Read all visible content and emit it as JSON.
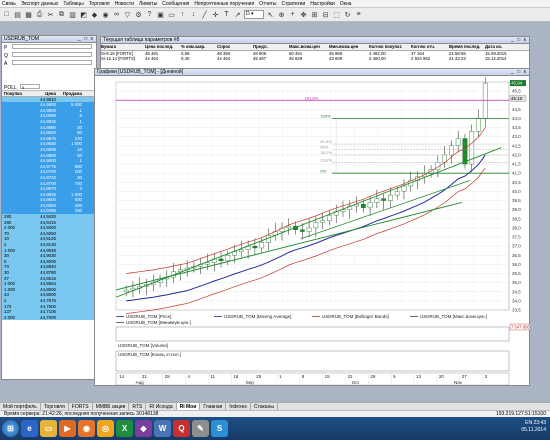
{
  "menu": [
    "Связь",
    "Экспорт данных",
    "Таблицы",
    "Торговля",
    "Новости",
    "Лимиты",
    "Сообщения",
    "Непрочтенные поручения",
    "Отчеты",
    "Стратегии",
    "Настройки",
    "Окна"
  ],
  "toolbar": {
    "interval": "D"
  },
  "left_panel": {
    "title": "USDRUB_TOM",
    "price_label": "P",
    "qty_label": "Q",
    "side_label": "A",
    "poll_label": "POLL",
    "poll_value": "0",
    "headers": [
      "Покупка",
      "Цена",
      "Продажа"
    ],
    "rows": [
      [
        "",
        "44,9810",
        ""
      ],
      [
        "",
        "44,9800",
        "5 000"
      ],
      [
        "",
        "44,9900",
        "1"
      ],
      [
        "",
        "44,9990",
        "5"
      ],
      [
        "",
        "44,9925",
        "1"
      ],
      [
        "",
        "44,9880",
        "20"
      ],
      [
        "",
        "44,9620",
        "90"
      ],
      [
        "",
        "44,9575",
        "120"
      ],
      [
        "",
        "44,9550",
        "1 000"
      ],
      [
        "",
        "44,9505",
        "10"
      ],
      [
        "",
        "44,9500",
        "50"
      ],
      [
        "",
        "44,9000",
        "1"
      ],
      [
        "",
        "44,9775",
        "500"
      ],
      [
        "",
        "44,9700",
        "100"
      ],
      [
        "",
        "44,9733",
        "30"
      ],
      [
        "",
        "44,9700",
        "700"
      ],
      [
        "",
        "44,9670",
        "3"
      ],
      [
        "",
        "44,9635",
        "1 000"
      ],
      [
        "",
        "44,9600",
        "500"
      ],
      [
        "",
        "44,9550",
        "400"
      ],
      [
        "",
        "44,9495",
        "150"
      ],
      [
        "280",
        "44,9420",
        ""
      ],
      [
        "280",
        "44,9415",
        ""
      ],
      [
        "2 000",
        "44,9400",
        ""
      ],
      [
        "70",
        "44,9250",
        ""
      ],
      [
        "10",
        "44,9125",
        ""
      ],
      [
        "2",
        "44,9120",
        ""
      ],
      [
        "1 000",
        "44,9048",
        ""
      ],
      [
        "30",
        "44,9030",
        ""
      ],
      [
        "5",
        "44,9000",
        ""
      ],
      [
        "70",
        "44,8840",
        ""
      ],
      [
        "30",
        "44,8780",
        ""
      ],
      [
        "37",
        "44,8615",
        ""
      ],
      [
        "1 000",
        "44,8564",
        ""
      ],
      [
        "1 000",
        "44,8560",
        ""
      ],
      [
        "43",
        "44,8000",
        ""
      ],
      [
        "2",
        "44,7675",
        ""
      ],
      [
        "170",
        "44,7500",
        ""
      ],
      [
        "137",
        "44,7105",
        ""
      ],
      [
        "2 000",
        "44,7000",
        ""
      ]
    ]
  },
  "params_table": {
    "title": "Текущая таблица параметров #8",
    "headers": [
      "Бумага",
      "Цена послед.",
      "% изм.закр.",
      "Спрос",
      "Предл.",
      "Макс.возм.цен",
      "Мин.возм.цен",
      "Кол-во покупат.",
      "Кол-во отч.",
      "Время послед.",
      "Дата из."
    ],
    "rows": [
      [
        "Si-9.15 [FORTS]",
        "48 481",
        "0,58",
        "48 350",
        "48 806",
        "50 451",
        "45 969",
        "4 482,00",
        "37 164",
        "21:58:55",
        "15.09.2015"
      ],
      [
        "Si-12.14 [FORTS]",
        "44 464",
        "0,40",
        "44 464",
        "45 467",
        "46 828",
        "43 609",
        "2 460,00",
        "2 924 962",
        "21:42:23",
        "15.12.2014"
      ]
    ]
  },
  "chart": {
    "title": "Графики [USDRUB_TOM] - [Дневной]",
    "legend_main": [
      "USDRUB_TOM [Price]",
      "USDRUB_TOM [Moving Average]",
      "USDRUB_TOM [Bollinger Bands]",
      "USDRUB_TOM [Макс.возм.цен.]",
      "USDRUB_TOM [Минимум цен.]"
    ],
    "legend_volume": "USDRUB_TOM [Volume]",
    "legend_oi": "USDRUB_TOM [Конец от.пол.]",
    "price_ticks": [
      "46,0",
      "45,5",
      "45,0",
      "44,5",
      "44,0",
      "43,5",
      "43,0",
      "42,5",
      "42,0",
      "41,5",
      "41,0",
      "40,5",
      "40,0",
      "39,5",
      "39,0",
      "38,5",
      "38,0",
      "37,5",
      "37,0",
      "36,5",
      "36,0",
      "35,5",
      "35,0",
      "34,5",
      "34,0",
      "33,5"
    ],
    "last_price": "45,94",
    "secondary_price": "45,10",
    "volume_value": "7 547 956",
    "fib_levels": [
      "161,8%",
      "100%",
      "61,8%",
      "50%",
      "38,2%",
      "23,6%",
      "0%"
    ],
    "date_ticks": [
      "14",
      "21",
      "28",
      "4",
      "11",
      "18",
      "25",
      "1",
      "8",
      "15",
      "22",
      "29",
      "6",
      "13",
      "20",
      "27",
      "3"
    ],
    "month_ticks": [
      "Aug",
      "Sep",
      "Oct",
      "Nov"
    ]
  },
  "chart_data": {
    "type": "candlestick",
    "title": "Графики [USDRUB_TOM] - [Дневной]",
    "ylim": [
      33.5,
      46.0
    ],
    "price_range": [
      34.3,
      45.94
    ],
    "series": [
      {
        "name": "USDRUB_TOM [Price]",
        "close": [
          34.6,
          34.7,
          34.8,
          34.9,
          35.0,
          35.2,
          35.3,
          35.6,
          35.7,
          35.8,
          35.9,
          36.0,
          36.1,
          36.3,
          36.2,
          36.5,
          36.7,
          36.8,
          37.0,
          36.9,
          37.2,
          37.6,
          37.8,
          38.0,
          38.1,
          37.9,
          37.8,
          38.0,
          38.3,
          38.4,
          38.7,
          38.9,
          39.0,
          39.2,
          39.3,
          39.1,
          39.4,
          39.6,
          39.5,
          39.8,
          40.0,
          40.3,
          40.6,
          40.8,
          41.0,
          41.2,
          41.6,
          42.0,
          42.5,
          42.9,
          41.5,
          43.3,
          44.0,
          45.94
        ]
      },
      {
        "name": "USDRUB_TOM [Moving Average]"
      },
      {
        "name": "USDRUB_TOM [Bollinger Bands]"
      }
    ],
    "volume": 7547956
  },
  "tabs": [
    "Мой портфель",
    "Торговля",
    "FORTS",
    "ММВБ акции",
    "RTS",
    "RI Исхода",
    "RI Мои",
    "Главная",
    "Indexes",
    "Стаканы"
  ],
  "tabs_active": "RI Мои",
  "status": {
    "left": "Время сервера: 21:42:26; последняя полученная запись 30148138",
    "right": "193.219.127.51:15100",
    "lang": "EN"
  },
  "taskbar": {
    "time": "23:43",
    "date": "05.11.2014",
    "notify": "05.11.2014"
  }
}
